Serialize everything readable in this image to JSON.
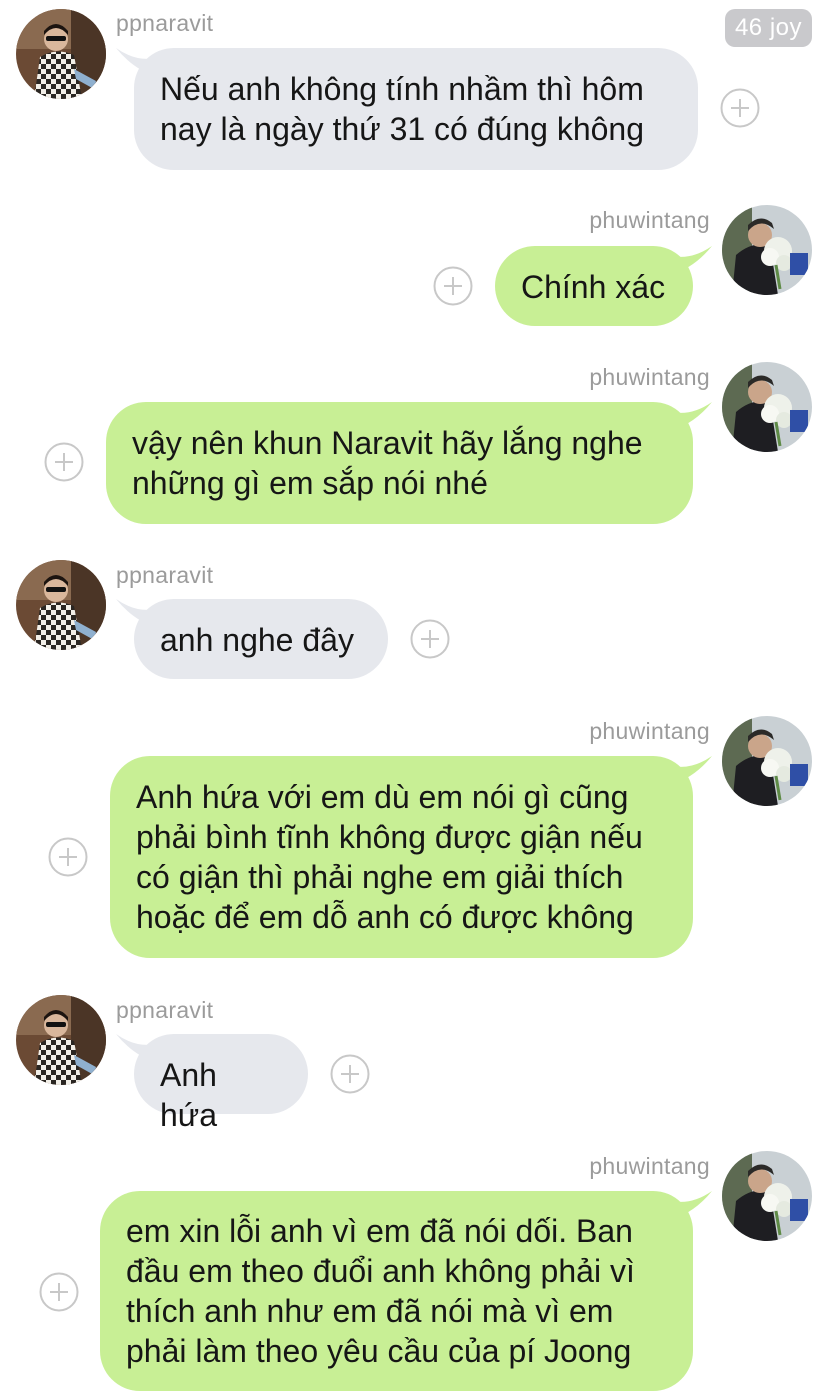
{
  "header": {
    "badge": "46 joy"
  },
  "users": {
    "left": "ppnaravit",
    "right": "phuwintang"
  },
  "messages": [
    {
      "side": "left",
      "sender": "ppnaravit",
      "lines": [
        "Nếu anh không tính nhầm thì hôm",
        "nay là ngày thứ 31 có đúng không"
      ]
    },
    {
      "side": "right",
      "sender": "phuwintang",
      "lines": [
        "Chính xác"
      ]
    },
    {
      "side": "right",
      "sender": "phuwintang",
      "lines": [
        "vậy nên khun Naravit hãy lắng nghe",
        "những gì em sắp nói nhé"
      ]
    },
    {
      "side": "left",
      "sender": "ppnaravit",
      "lines": [
        "anh nghe đây"
      ]
    },
    {
      "side": "right",
      "sender": "phuwintang",
      "lines": [
        "Anh hứa với em dù em nói gì cũng",
        "phải bình tĩnh không được giận nếu",
        "có giận thì phải nghe em giải thích",
        "hoặc để em dỗ anh có được không"
      ]
    },
    {
      "side": "left",
      "sender": "ppnaravit",
      "lines": [
        "Anh hứa"
      ]
    },
    {
      "side": "right",
      "sender": "phuwintang",
      "lines": [
        "em xin lỗi anh vì em đã nói dối. Ban",
        "đầu em theo đuổi anh không phải vì",
        "thích anh như em đã nói mà vì em",
        "phải làm theo yêu cầu của pí Joong"
      ]
    }
  ],
  "colors": {
    "gray_bubble": "#e6e8ed",
    "green_bubble": "#c8ef95",
    "text": "#161616",
    "meta": "#9b9b9b"
  },
  "icons": {
    "add": "plus-circle-icon",
    "avatar_left": "avatar-ppnaravit",
    "avatar_right": "avatar-phuwintang"
  }
}
